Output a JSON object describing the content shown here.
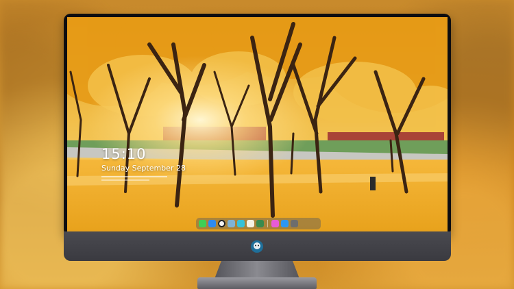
{
  "lock_screen": {
    "time": "15:10",
    "date": "Sunday September 28"
  },
  "dock": {
    "apps": [
      {
        "icon": "messages-icon",
        "color": "#3ecf55"
      },
      {
        "icon": "finder-icon",
        "color": "#2e8bf0"
      },
      {
        "icon": "clock-icon",
        "color": "#f4f4f4"
      },
      {
        "icon": "preview-icon",
        "color": "#7fb3d5"
      },
      {
        "icon": "clapperboard-icon",
        "color": "#36c2d8"
      },
      {
        "icon": "notes-icon",
        "color": "#f5f2e4"
      },
      {
        "icon": "photos-icon",
        "color": "#3a8a4e"
      },
      {
        "icon": "itunes-icon",
        "color": "#e85ad6"
      },
      {
        "icon": "app-store-icon",
        "color": "#2e97f2"
      },
      {
        "icon": "camera-icon",
        "color": "#6d6d6d"
      }
    ]
  },
  "colors": {
    "bezel": "#0d0d10",
    "chin": "#45454b",
    "foliage": "#f0b32d"
  }
}
